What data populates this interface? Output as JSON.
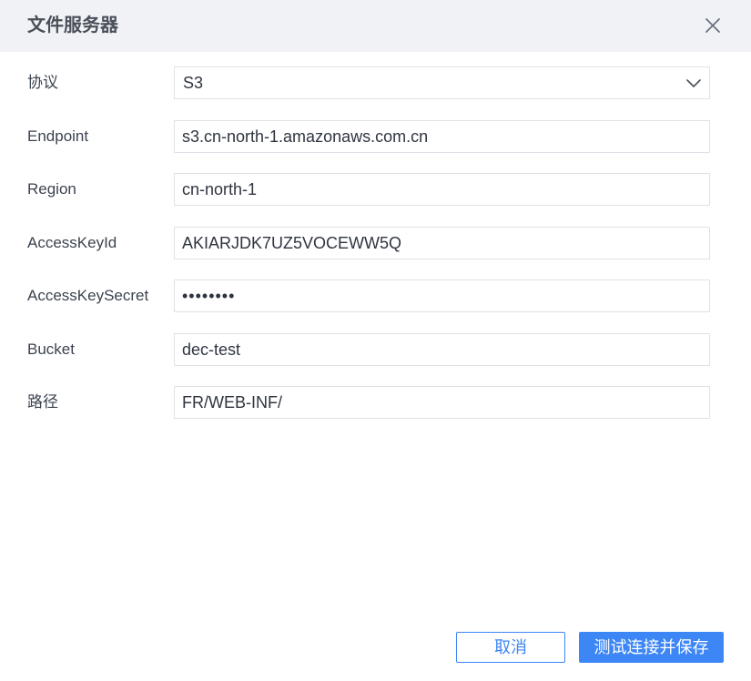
{
  "dialog": {
    "title": "文件服务器",
    "close_icon": "close-icon"
  },
  "form": {
    "protocol": {
      "label": "协议",
      "value": "S3",
      "icon": "chevron-down-icon"
    },
    "endpoint": {
      "label": "Endpoint",
      "value": "s3.cn-north-1.amazonaws.com.cn"
    },
    "region": {
      "label": "Region",
      "value": "cn-north-1"
    },
    "access_key_id": {
      "label": "AccessKeyId",
      "value": "AKIARJDK7UZ5VOCEWW5Q"
    },
    "access_key_secret": {
      "label": "AccessKeySecret",
      "value": "••••••••"
    },
    "bucket": {
      "label": "Bucket",
      "value": "dec-test"
    },
    "path": {
      "label": "路径",
      "value": "FR/WEB-INF/"
    }
  },
  "footer": {
    "cancel_label": "取消",
    "save_label": "测试连接并保存"
  },
  "colors": {
    "accent": "#3d86f5",
    "titlebar_bg": "#f1f2f5",
    "border": "#dde1e7"
  }
}
